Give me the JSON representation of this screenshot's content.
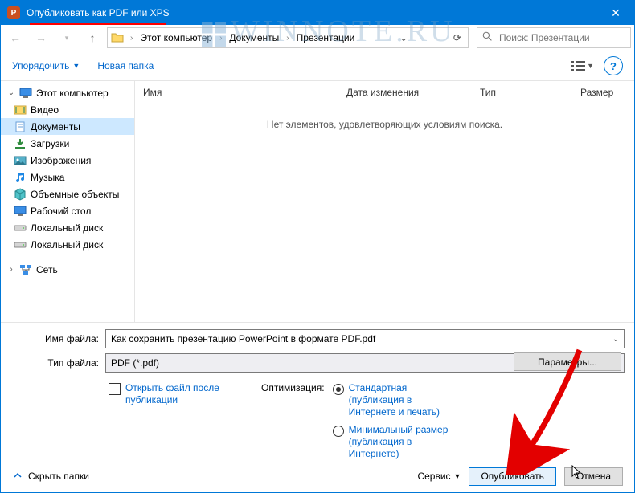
{
  "title": "Опубликовать как PDF или XPS",
  "watermark": "WINNOTE.RU",
  "breadcrumb": {
    "root": "Этот компьютер",
    "doc": "Документы",
    "pres": "Презентации"
  },
  "search": {
    "placeholder": "Поиск: Презентации"
  },
  "toolbar": {
    "organize": "Упорядочить",
    "newfolder": "Новая папка"
  },
  "columns": {
    "name": "Имя",
    "date": "Дата изменения",
    "type": "Тип",
    "size": "Размер"
  },
  "empty": "Нет элементов, удовлетворяющих условиям поиска.",
  "tree": {
    "pc": "Этот компьютер",
    "video": "Видео",
    "docs": "Документы",
    "down": "Загрузки",
    "img": "Изображения",
    "music": "Музыка",
    "obj": "Объемные объекты",
    "desk": "Рабочий стол",
    "disk1": "Локальный диск",
    "disk2": "Локальный диск",
    "net": "Сеть"
  },
  "labels": {
    "fname": "Имя файла:",
    "ftype": "Тип файла:"
  },
  "values": {
    "fname": "Как сохранить презентацию PowerPoint в формате PDF.pdf",
    "ftype": "PDF (*.pdf)"
  },
  "openafter": "Открыть файл после публикации",
  "optim": {
    "label": "Оптимизация:",
    "std": "Стандартная (публикация в Интернете и печать)",
    "min": "Минимальный размер (публикация в Интернете)"
  },
  "buttons": {
    "params": "Параметры...",
    "service": "Сервис",
    "publish": "Опубликовать",
    "cancel": "Отмена",
    "hide": "Скрыть папки"
  }
}
